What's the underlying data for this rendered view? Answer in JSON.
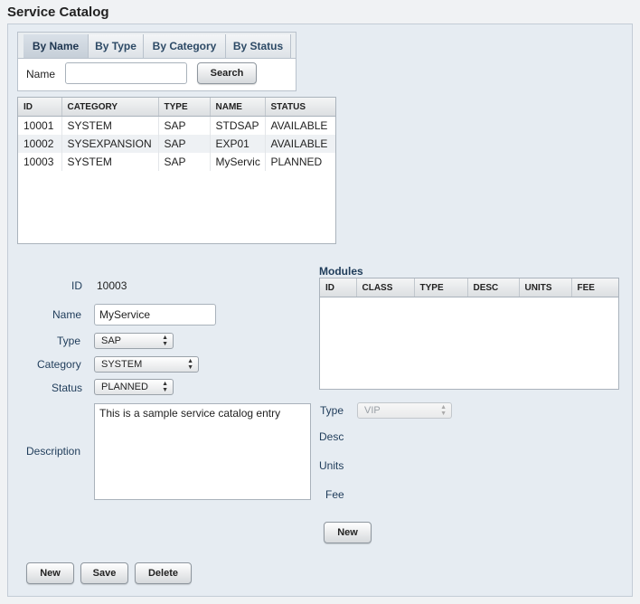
{
  "page": {
    "title": "Service Catalog"
  },
  "search": {
    "tabs": [
      "By Name",
      "By Type",
      "By Category",
      "By Status"
    ],
    "active_tab": "By Name",
    "name_label": "Name",
    "name_value": "",
    "search_button": "Search"
  },
  "results": {
    "columns": [
      "ID",
      "CATEGORY",
      "TYPE",
      "NAME",
      "STATUS"
    ],
    "rows": [
      [
        "10001",
        "SYSTEM",
        "SAP",
        "STDSAP",
        "AVAILABLE"
      ],
      [
        "10002",
        "SYSEXPANSION",
        "SAP",
        "EXP01",
        "AVAILABLE"
      ],
      [
        "10003",
        "SYSTEM",
        "SAP",
        "MyServic",
        "PLANNED"
      ]
    ]
  },
  "detail": {
    "id_label": "ID",
    "id_value": "10003",
    "name_label": "Name",
    "name_value": "MyService",
    "type_label": "Type",
    "type_value": "SAP",
    "category_label": "Category",
    "category_value": "SYSTEM",
    "status_label": "Status",
    "status_value": "PLANNED",
    "description_label": "Description",
    "description_value": "This is a sample service catalog entry"
  },
  "modules": {
    "title": "Modules",
    "columns": [
      "ID",
      "CLASS",
      "TYPE",
      "DESC",
      "UNITS",
      "FEE"
    ],
    "rows": [],
    "type_label": "Type",
    "type_value": "VIP",
    "desc_label": "Desc",
    "units_label": "Units",
    "fee_label": "Fee",
    "new_button": "New"
  },
  "actions": {
    "new": "New",
    "save": "Save",
    "delete": "Delete"
  }
}
